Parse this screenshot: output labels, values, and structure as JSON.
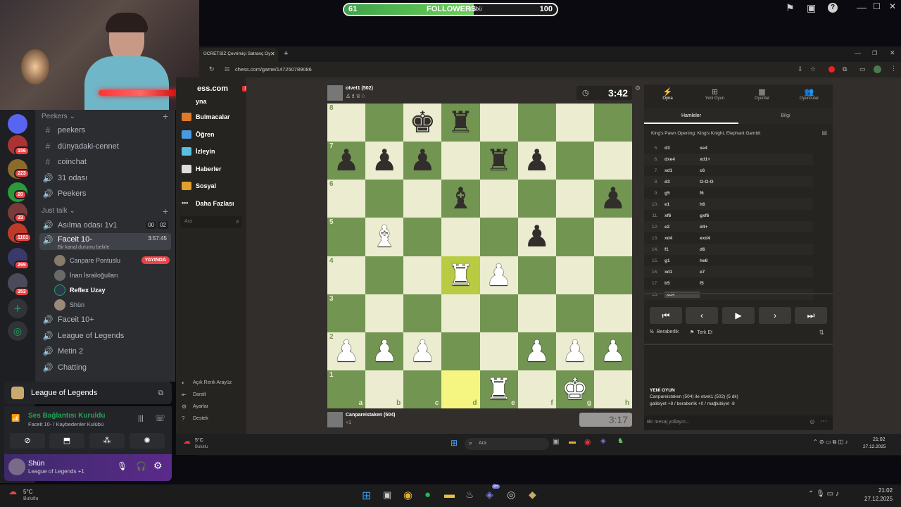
{
  "followers": {
    "current": "61",
    "label": "FOLLOWERS",
    "overlay": "ulübü",
    "goal": "100",
    "progress_fraction": 0.61
  },
  "stream_icons": [
    "flag-icon",
    "video-icon",
    "help-icon"
  ],
  "window_controls": {
    "minimize": "—",
    "maximize": "☐",
    "close": "✕"
  },
  "discord": {
    "servers": [
      {
        "badge": "156"
      },
      {
        "badge": "223"
      },
      {
        "badge": "20"
      },
      {
        "badge": "33"
      },
      {
        "badge": "1101"
      },
      {
        "badge": "269"
      },
      {
        "badge": "353"
      }
    ],
    "categories": {
      "peekers": "Peekers",
      "just_talk": "Just talk"
    },
    "peekers_channels": [
      {
        "icon": "#",
        "name": "peekers"
      },
      {
        "icon": "#",
        "name": "dünyadaki-cennet"
      },
      {
        "icon": "#",
        "name": "coinchat"
      },
      {
        "icon": "🔊",
        "name": "31 odası"
      },
      {
        "icon": "🔊",
        "name": "Peekers"
      }
    ],
    "asilma": {
      "name": "Asılma odası 1v1",
      "c1": "00",
      "c2": "02"
    },
    "faceit": {
      "name": "Faceit 10-",
      "time": "3:57:45",
      "status": "Bir kanal durumu belirle"
    },
    "users": [
      {
        "name": "Canpare Pontuslu",
        "badge": "YAYINDA"
      },
      {
        "name": "İnan İsrailoğulları",
        "badge": ""
      },
      {
        "name": "Reflex Uzay",
        "badge": ""
      },
      {
        "name": "Shün",
        "badge": ""
      }
    ],
    "more_channels": [
      "Faceit 10+",
      "League of Legends",
      "Metin 2",
      "Chatting"
    ],
    "activity": {
      "game": "League of Legends"
    },
    "voice": {
      "status": "Ses Bağlantısı Kuruldu",
      "channel": "Faceit 10- / Kaybedenler Kulübü"
    },
    "user": {
      "name": "Shün",
      "activity": "League of Legends +1"
    }
  },
  "browser": {
    "tab_title": "ÜCRETSİZ Çevrimiçi Satranç Oy",
    "url": "chess.com/game/147250789086"
  },
  "chess_nav": {
    "logo": "ess.com",
    "notif": "1",
    "items": [
      "yna",
      "Bulmacalar",
      "Öğren",
      "İzleyin",
      "Haberler",
      "Sosyal",
      "Daha Fazlası"
    ],
    "search_placeholder": "Ara",
    "bottom": [
      "Açık Renk Arayüz",
      "Daralt",
      "Ayarlar",
      "Destek"
    ]
  },
  "game": {
    "top_player": "otvet1 (502)",
    "top_clock": "3:42",
    "bottom_player": "Canpareistaken (504)",
    "bottom_clock": "3:17",
    "bottom_extra": "+1",
    "board_ranks": [
      "8",
      "7",
      "6",
      "5",
      "4",
      "3",
      "2",
      "1"
    ],
    "board_files": [
      "a",
      "b",
      "c",
      "d",
      "e",
      "f",
      "g",
      "h"
    ],
    "pieces": [
      {
        "sq": "c8",
        "p": "♚",
        "c": "b"
      },
      {
        "sq": "d8",
        "p": "♜",
        "c": "b"
      },
      {
        "sq": "a7",
        "p": "♟",
        "c": "b"
      },
      {
        "sq": "b7",
        "p": "♟",
        "c": "b"
      },
      {
        "sq": "c7",
        "p": "♟",
        "c": "b"
      },
      {
        "sq": "e7",
        "p": "♜",
        "c": "b"
      },
      {
        "sq": "f7",
        "p": "♟",
        "c": "b"
      },
      {
        "sq": "d6",
        "p": "♝",
        "c": "b"
      },
      {
        "sq": "h6",
        "p": "♟",
        "c": "b"
      },
      {
        "sq": "b5",
        "p": "♝",
        "c": "w"
      },
      {
        "sq": "f5",
        "p": "♟",
        "c": "b"
      },
      {
        "sq": "d4",
        "p": "♜",
        "c": "w"
      },
      {
        "sq": "e4",
        "p": "♟",
        "c": "w"
      },
      {
        "sq": "a2",
        "p": "♟",
        "c": "w"
      },
      {
        "sq": "b2",
        "p": "♟",
        "c": "w"
      },
      {
        "sq": "c2",
        "p": "♟",
        "c": "w"
      },
      {
        "sq": "f2",
        "p": "♟",
        "c": "w"
      },
      {
        "sq": "g2",
        "p": "♟",
        "c": "w"
      },
      {
        "sq": "h2",
        "p": "♟",
        "c": "w"
      },
      {
        "sq": "e1",
        "p": "♜",
        "c": "w"
      },
      {
        "sq": "g1",
        "p": "♚",
        "c": "w"
      }
    ],
    "highlights": [
      "d4",
      "d1"
    ]
  },
  "panel": {
    "tabs": [
      {
        "icon": "⚡",
        "label": "Oyna"
      },
      {
        "icon": "⊞",
        "label": "Yeni Oyun"
      },
      {
        "icon": "▦",
        "label": "Oyunlar"
      },
      {
        "icon": "👥",
        "label": "Oyuncular"
      }
    ],
    "subtabs": [
      "Hamleler",
      "Bilgi"
    ],
    "opening": "King's Pawn Opening: King's Knight, Elephant Gambit",
    "moves": [
      {
        "n": "5.",
        "w": "d3",
        "b": "xe4"
      },
      {
        "n": "6.",
        "w": "dxe4",
        "b": "xd1+"
      },
      {
        "n": "7.",
        "w": "xd1",
        "b": "c6"
      },
      {
        "n": "8.",
        "w": "d3",
        "b": "O-O-O"
      },
      {
        "n": "9.",
        "w": "g5",
        "b": "f6"
      },
      {
        "n": "10.",
        "w": "e1",
        "b": "h6"
      },
      {
        "n": "11.",
        "w": "xf6",
        "b": "gxf6"
      },
      {
        "n": "12.",
        "w": "e2",
        "b": "d4+"
      },
      {
        "n": "13.",
        "w": "xd4",
        "b": "exd4"
      },
      {
        "n": "14.",
        "w": "f1",
        "b": "d6"
      },
      {
        "n": "15.",
        "w": "g1",
        "b": "he8"
      },
      {
        "n": "16.",
        "w": "xd1",
        "b": "e7"
      },
      {
        "n": "17.",
        "w": "b5",
        "b": "f5"
      },
      {
        "n": "18.",
        "w": "xd4",
        "b": ""
      }
    ],
    "controls": [
      "⏮",
      "‹",
      "▶",
      "›",
      "⏭"
    ],
    "draw": "Beraberlik",
    "resign": "Terk Et",
    "new_game_title": "YENİ OYUN",
    "new_game_line1": "Canpareistaken (504) ile otvet1 (502) (5 dk)",
    "new_game_line2": "galibiyet +8 / beraberlik +0 / mağlubiyet -8",
    "chat_placeholder": "Bir mesaj yollayın..."
  },
  "inner_taskbar": {
    "weather": "5°C",
    "weather_desc": "Bulutlu",
    "search": "Ara",
    "time": "21:02",
    "date": "27.12.2025"
  },
  "taskbar": {
    "weather": "5°C",
    "weather_desc": "Bulutlu",
    "time": "21:02",
    "date": "27.12.2025",
    "notif": "9+"
  }
}
